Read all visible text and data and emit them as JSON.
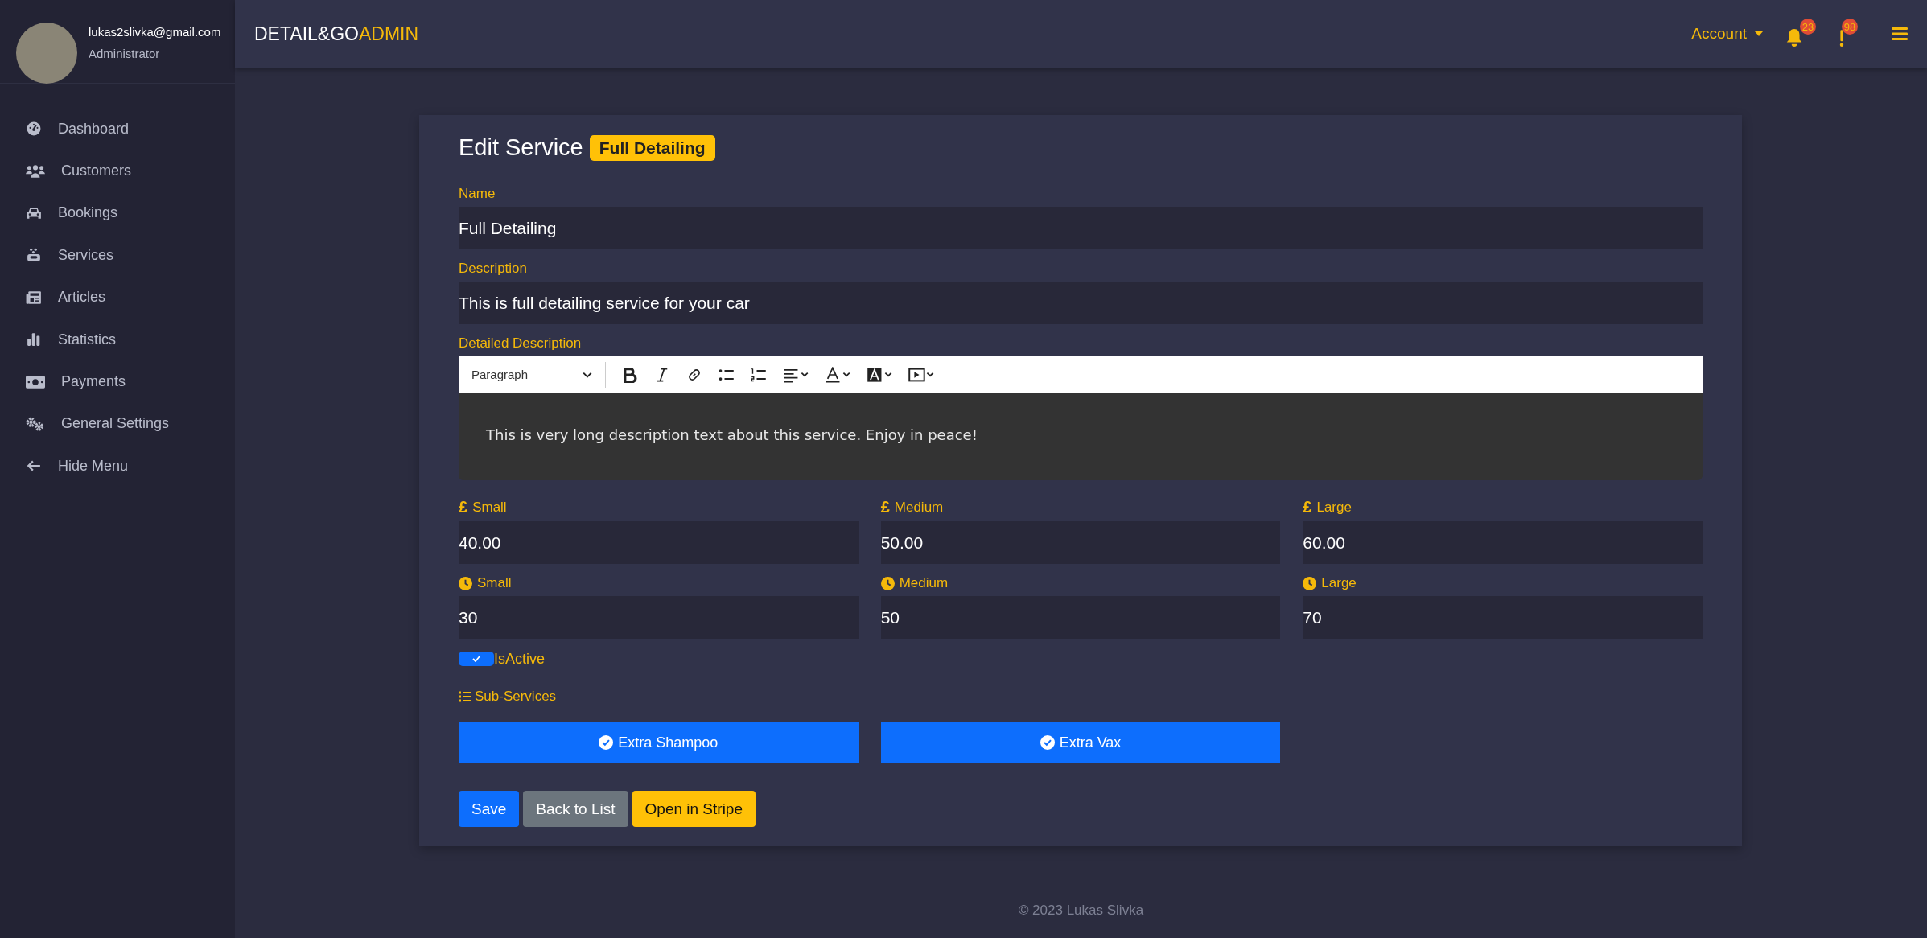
{
  "user": {
    "email": "lukas2slivka@gmail.com",
    "role": "Administrator"
  },
  "sidebar": {
    "items": [
      {
        "label": "Dashboard",
        "kind": "dashboard"
      },
      {
        "label": "Customers",
        "kind": "customers"
      },
      {
        "label": "Bookings",
        "kind": "bookings"
      },
      {
        "label": "Services",
        "kind": "services"
      },
      {
        "label": "Articles",
        "kind": "articles"
      },
      {
        "label": "Statistics",
        "kind": "statistics"
      },
      {
        "label": "Payments",
        "kind": "payments"
      },
      {
        "label": "General Settings",
        "kind": "settings"
      },
      {
        "label": "Hide Menu",
        "kind": "hide"
      }
    ]
  },
  "topbar": {
    "brand": "DETAIL&GO",
    "brand_accent": "ADMIN",
    "account": "Account",
    "notifications_count": "23",
    "alerts_count": "98"
  },
  "form": {
    "title": "Edit Service",
    "badge": "Full Detailing",
    "name": {
      "label": "Name",
      "value": "Full Detailing"
    },
    "description": {
      "label": "Description",
      "value": "This is full detailing service for your car"
    },
    "detailed_description": {
      "label": "Detailed Description",
      "block_format": "Paragraph",
      "content": "This is very long description text about this service. Enjoy in peace!"
    },
    "price_fields": [
      {
        "symbol": "£",
        "label": "Small",
        "value": "40.00"
      },
      {
        "symbol": "£",
        "label": "Medium",
        "value": "50.00"
      },
      {
        "symbol": "£",
        "label": "Large",
        "value": "60.00"
      }
    ],
    "duration_fields": [
      {
        "label": "Small",
        "value": "30"
      },
      {
        "label": "Medium",
        "value": "50"
      },
      {
        "label": "Large",
        "value": "70"
      }
    ],
    "is_active": {
      "label": "IsActive",
      "checked": true
    },
    "sub_services": {
      "label": "Sub-Services",
      "items": [
        {
          "label": "Extra Shampoo",
          "selected": true
        },
        {
          "label": "Extra Vax",
          "selected": true
        }
      ]
    },
    "buttons": [
      {
        "label": "Save",
        "kind": "primary"
      },
      {
        "label": "Back to List",
        "kind": "secondary"
      },
      {
        "label": "Open in Stripe",
        "kind": "warning"
      }
    ]
  },
  "footer": "© 2023 Lukas Slivka"
}
